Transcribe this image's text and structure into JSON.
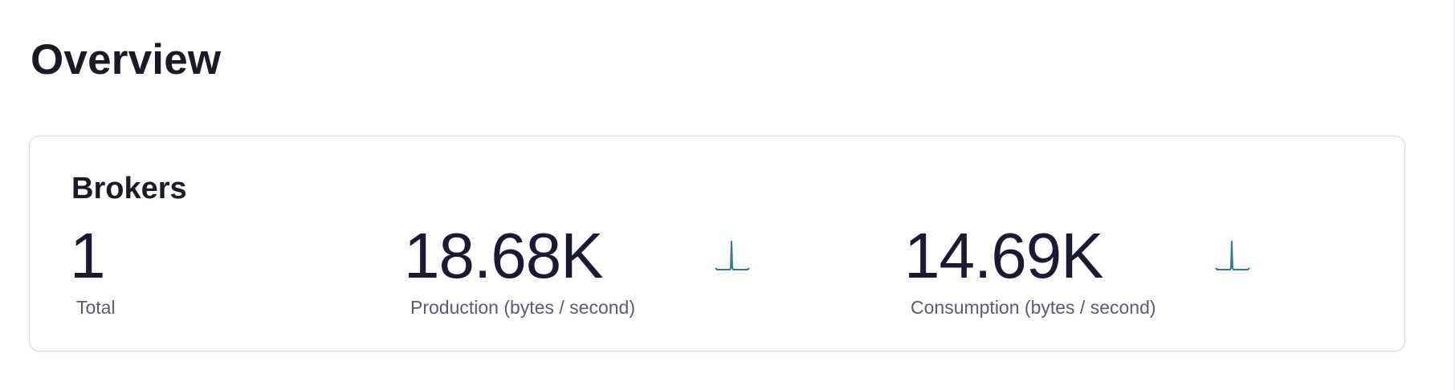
{
  "page": {
    "title": "Overview"
  },
  "brokers": {
    "title": "Brokers",
    "total": {
      "value": "1",
      "label": "Total"
    },
    "production": {
      "value": "18.68K",
      "label": "Production (bytes / second)",
      "sparkline_color": "#2a7f88"
    },
    "consumption": {
      "value": "14.69K",
      "label": "Consumption (bytes / second)",
      "sparkline_color": "#2a7f88"
    }
  }
}
